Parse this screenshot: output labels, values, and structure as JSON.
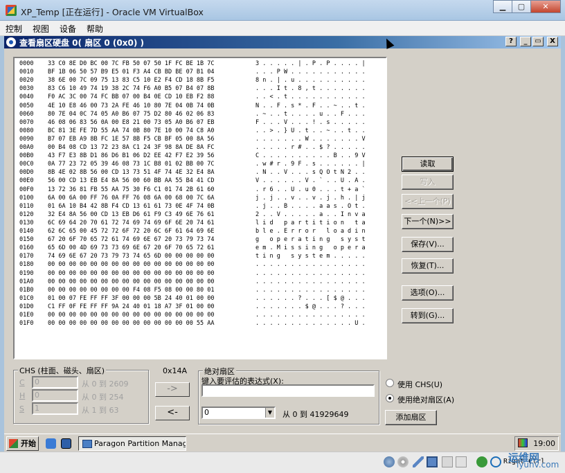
{
  "window": {
    "title": "XP_Temp [正在运行] - Oracle VM VirtualBox",
    "buttons": {
      "minimize": "▁",
      "maximize": "▢",
      "close": "✕"
    }
  },
  "menu": [
    "控制",
    "视图",
    "设备",
    "帮助"
  ],
  "dialog": {
    "title": "查看扇区硬盘 0( 扇区 0 (0x0) )",
    "caption_buttons": {
      "help": "?",
      "min": "_",
      "restore": "▭",
      "close": "X"
    }
  },
  "hex_rows": [
    {
      "off": "0000",
      "hex": "33 C0 8E D0 BC 00 7C FB 50 07 50 1F FC BE 1B 7C",
      "asc": "3 . . . . . | . P . P . . . . |"
    },
    {
      "off": "0010",
      "hex": "BF 1B 06 50 57 B9 E5 01 F3 A4 CB BD BE 07 B1 04",
      "asc": ". . . P W . . . . . . . . . . ."
    },
    {
      "off": "0020",
      "hex": "38 6E 00 7C 09 75 13 83 C5 10 E2 F4 CD 18 8B F5",
      "asc": "8 n . | . u . . . . . . . . . ."
    },
    {
      "off": "0030",
      "hex": "83 C6 10 49 74 19 38 2C 74 F6 A0 B5 07 B4 07 8B",
      "asc": ". . . I t . 8 , t . . . . . . ."
    },
    {
      "off": "0040",
      "hex": "F0 AC 3C 00 74 FC BB 07 00 B4 0E CD 10 EB F2 88",
      "asc": ". . < . t . . . . . . . . . . ."
    },
    {
      "off": "0050",
      "hex": "4E 10 E8 46 00 73 2A FE 46 10 80 7E 04 0B 74 0B",
      "asc": "N . . F . s * . F . . ~ . . t ."
    },
    {
      "off": "0060",
      "hex": "80 7E 04 0C 74 05 A0 B6 07 75 D2 80 46 02 06 83",
      "asc": ". ~ . . t . . . . u . . F . . ."
    },
    {
      "off": "0070",
      "hex": "46 08 06 83 56 0A 00 E8 21 00 73 05 A0 B6 07 EB",
      "asc": "F . . . V . . . ! . s . . . . ."
    },
    {
      "off": "0080",
      "hex": "BC 81 3E FE 7D 55 AA 74 0B 80 7E 10 00 74 C8 A0",
      "asc": ". . > . } U . t . . ~ . . t . ."
    },
    {
      "off": "0090",
      "hex": "B7 07 EB A9 8B FC 1E 57 8B F5 CB BF 05 00 8A 56",
      "asc": ". . . . . . . W . . . . . . . V"
    },
    {
      "off": "00A0",
      "hex": "00 B4 08 CD 13 72 23 8A C1 24 3F 98 8A DE 8A FC",
      "asc": ". . . . . r # . . $ ? . . . . ."
    },
    {
      "off": "00B0",
      "hex": "43 F7 E3 8B D1 86 D6 B1 06 D2 EE 42 F7 E2 39 56",
      "asc": "C . . . . . . . . . . B . . 9 V"
    },
    {
      "off": "00C0",
      "hex": "0A 77 23 72 05 39 46 08 73 1C B8 01 02 BB 00 7C",
      "asc": ". w # r . 9 F . s . . . . . . |"
    },
    {
      "off": "00D0",
      "hex": "8B 4E 02 8B 56 00 CD 13 73 51 4F 74 4E 32 E4 8A",
      "asc": ". N . . V . . . s Q O t N 2 . ."
    },
    {
      "off": "00E0",
      "hex": "56 00 CD 13 EB E4 8A 56 00 60 BB AA 55 B4 41 CD",
      "asc": "V . . . . . . V . ` . . U . A ."
    },
    {
      "off": "00F0",
      "hex": "13 72 36 81 FB 55 AA 75 30 F6 C1 01 74 2B 61 60",
      "asc": ". r 6 . . U . u 0 . . . t + a `"
    },
    {
      "off": "0100",
      "hex": "6A 00 6A 00 FF 76 0A FF 76 08 6A 00 68 00 7C 6A",
      "asc": "j . j . . v . . v . j . h . | j"
    },
    {
      "off": "0110",
      "hex": "01 6A 10 B4 42 8B F4 CD 13 61 61 73 0E 4F 74 0B",
      "asc": ". j . . B . . . . a a s . O t ."
    },
    {
      "off": "0120",
      "hex": "32 E4 8A 56 00 CD 13 EB D6 61 F9 C3 49 6E 76 61",
      "asc": "2 . . V . . . . . a . . I n v a"
    },
    {
      "off": "0130",
      "hex": "6C 69 64 20 70 61 72 74 69 74 69 6F 6E 20 74 61",
      "asc": "l i d   p a r t i t i o n   t a"
    },
    {
      "off": "0140",
      "hex": "62 6C 65 00 45 72 72 6F 72 20 6C 6F 61 64 69 6E",
      "asc": "b l e . E r r o r   l o a d i n"
    },
    {
      "off": "0150",
      "hex": "67 20 6F 70 65 72 61 74 69 6E 67 20 73 79 73 74",
      "asc": "g   o p e r a t i n g   s y s t"
    },
    {
      "off": "0160",
      "hex": "65 6D 00 4D 69 73 73 69 6E 67 20 6F 70 65 72 61",
      "asc": "e m . M i s s i n g   o p e r a"
    },
    {
      "off": "0170",
      "hex": "74 69 6E 67 20 73 79 73 74 65 6D 00 00 00 00 00",
      "asc": "t i n g   s y s t e m . . . . ."
    },
    {
      "off": "0180",
      "hex": "00 00 00 00 00 00 00 00 00 00 00 00 00 00 00 00",
      "asc": ". . . . . . . . . . . . . . . ."
    },
    {
      "off": "0190",
      "hex": "00 00 00 00 00 00 00 00 00 00 00 00 00 00 00 00",
      "asc": ". . . . . . . . . . . . . . . ."
    },
    {
      "off": "01A0",
      "hex": "00 00 00 00 00 00 00 00 00 00 00 00 00 00 00 00",
      "asc": ". . . . . . . . . . . . . . . ."
    },
    {
      "off": "01B0",
      "hex": "00 00 00 00 00 00 00 00 F4 08 F5 08 00 00 80 01",
      "asc": ". . . . . . . . . . . . . . . ."
    },
    {
      "off": "01C0",
      "hex": "01 00 07 FE FF FF 3F 00 00 00 5B 24 40 01 00 00",
      "asc": ". . . . . . ? . . . [ $ @ . . ."
    },
    {
      "off": "01D0",
      "hex": "C1 FF 0F FE FF FF 9A 24 40 01 18 A7 3F 01 00 00",
      "asc": ". . . . . . . $ @ . . . ? . . ."
    },
    {
      "off": "01E0",
      "hex": "00 00 00 00 00 00 00 00 00 00 00 00 00 00 00 00",
      "asc": ". . . . . . . . . . . . . . . ."
    },
    {
      "off": "01F0",
      "hex": "00 00 00 00 00 00 00 00 00 00 00 00 00 00 55 AA",
      "asc": ". . . . . . . . . . . . . . U ."
    }
  ],
  "side_buttons": {
    "read": "读取",
    "write": "写入",
    "prev": "<<上一个(P)",
    "next": "下一个(N)>>",
    "save": "保存(V)...",
    "restore": "恢复(T)...",
    "options": "选项(O)...",
    "goto": "转到(G)..."
  },
  "chs": {
    "legend": "CHS (柱面、磁头、扇区)",
    "rows": [
      {
        "key": "C",
        "value": "0",
        "range": "从 0 到 2609"
      },
      {
        "key": "H",
        "value": "0",
        "range": "从 0 到 254"
      },
      {
        "key": "S",
        "value": "1",
        "range": "从 1 到 63"
      }
    ]
  },
  "offset_label": "0x14A",
  "arrow_right": "->",
  "arrow_left": "<-",
  "abs": {
    "legend": "绝对扇区",
    "expr_label": "键入要评估的表达式(X):",
    "expr_value": "",
    "sector_value": "0",
    "range": "从 0 到 41929649"
  },
  "mode": {
    "chs": "使用 CHS(U)",
    "abs": "使用绝对扇区(A)",
    "add": "添加扇区"
  },
  "taskbar": {
    "start": "开始",
    "task": "Paragon Partition Manag...",
    "clock": "19:00"
  },
  "status": {
    "hostkey": "Right Ctrl"
  },
  "watermark": {
    "line1": "运维网",
    "line2": "iyunv.com"
  }
}
